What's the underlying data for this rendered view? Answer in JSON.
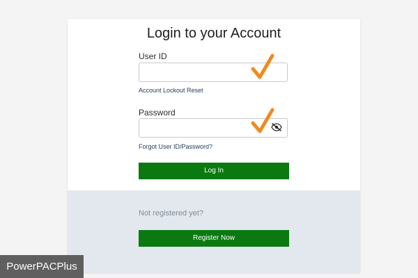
{
  "header": {
    "title": "Login to your Account"
  },
  "form": {
    "user_id_label": "User ID",
    "user_id_value": "",
    "account_lockout_link": "Account Lockout Reset",
    "password_label": "Password",
    "password_value": "",
    "forgot_link": "Forgot User ID/Password?",
    "login_button": "Log In"
  },
  "register": {
    "prompt": "Not registered yet?",
    "button": "Register Now"
  },
  "brand": {
    "label": "PowerPACPlus"
  },
  "colors": {
    "primary_button": "#0a7a10",
    "checkmark": "#f08a1c",
    "bottom_panel": "#e3e8ef"
  },
  "icons": {
    "checkmark": "checkmark-icon",
    "password_visibility": "eye-slash-icon"
  }
}
